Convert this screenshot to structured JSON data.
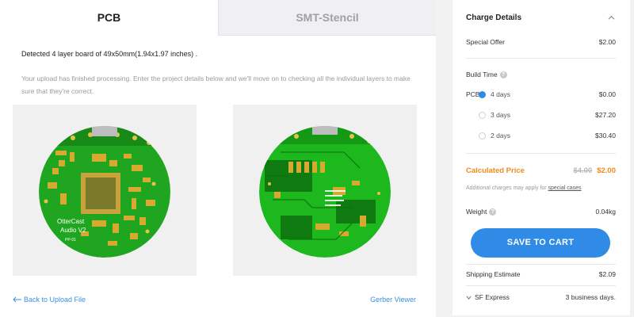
{
  "tabs": [
    {
      "label": "PCB",
      "active": true
    },
    {
      "label": "SMT-Stencil",
      "active": false
    }
  ],
  "upload": {
    "detected": "Detected 4 layer board of 49x50mm(1.94x1.97 inches) .",
    "note": "Your upload has finished processing. Enter the project details below and we'll move on to checking all the individual layers to make sure that they're correct."
  },
  "preview_top": {
    "silkscreen": [
      "OtterCast",
      "Audio V2"
    ],
    "rev": "PP-01"
  },
  "links": {
    "back": "Back to Upload File",
    "gerber": "Gerber Viewer"
  },
  "charge": {
    "title": "Charge Details",
    "special_offer_label": "Special Offer",
    "special_offer_value": "$2.00",
    "build_time_label": "Build Time",
    "pcb_label": "PCB:",
    "options": [
      {
        "label": "4 days",
        "price": "$0.00",
        "selected": true
      },
      {
        "label": "3 days",
        "price": "$27.20",
        "selected": false
      },
      {
        "label": "2 days",
        "price": "$30.40",
        "selected": false
      }
    ],
    "calculated_label": "Calculated Price",
    "old_price": "$4.00",
    "new_price": "$2.00",
    "additional_prefix": "Additional charges may apply for",
    "additional_link": "special cases",
    "weight_label": "Weight",
    "weight_value": "0.04kg",
    "cart_label": "SAVE TO CART",
    "shipping_label": "Shipping Estimate",
    "shipping_value": "$2.09",
    "carrier": "SF Express",
    "carrier_time": "3 business days."
  },
  "colors": {
    "accent": "#2f8be6",
    "price": "#f08a1c",
    "pcb_green": "#1fa51f",
    "copper": "#d4a52a"
  }
}
